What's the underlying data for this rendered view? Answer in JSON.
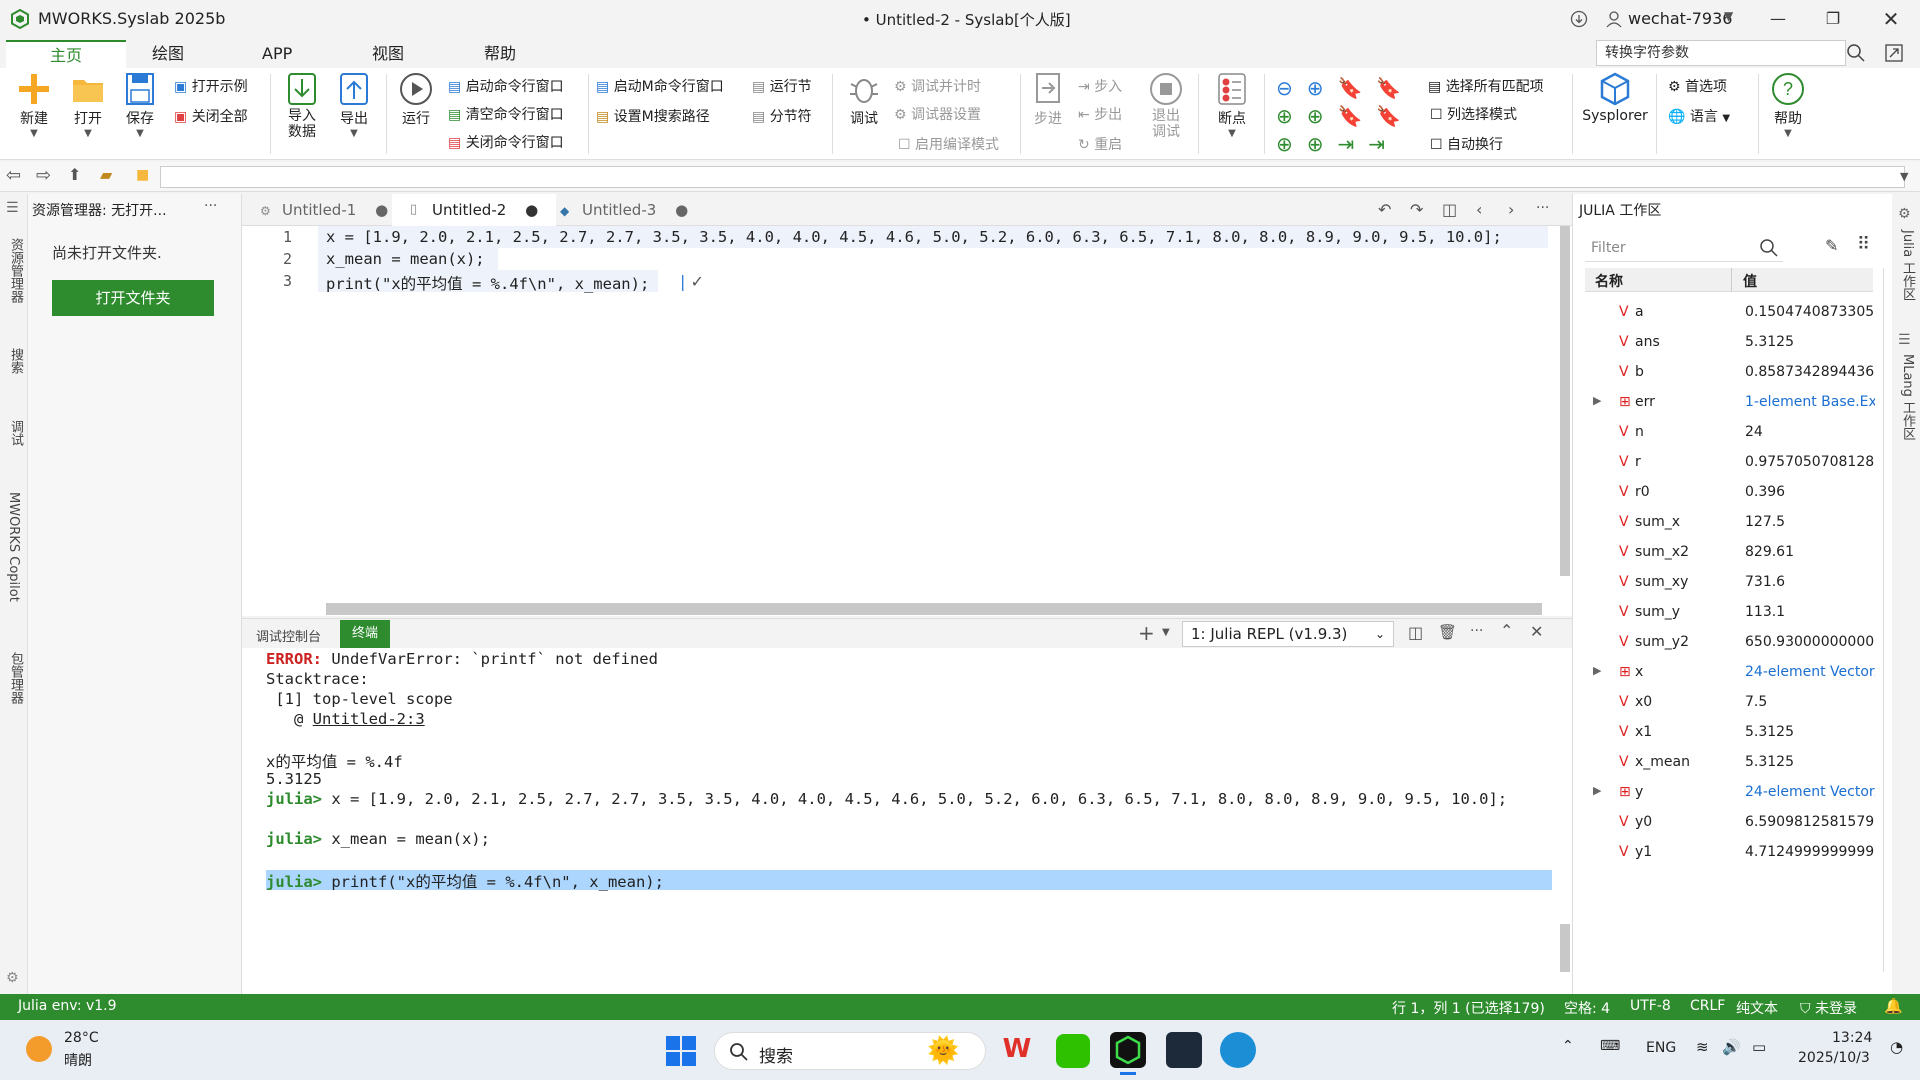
{
  "window": {
    "app_title": "MWORKS.Syslab 2025b",
    "doc_title": "• Untitled-2 - Syslab[个人版]",
    "user": "wechat-7936"
  },
  "menu_tabs": [
    "主页",
    "绘图",
    "APP",
    "视图",
    "帮助"
  ],
  "search_placeholder": "转换字符参数",
  "ribbon": {
    "new": "新建",
    "open": "打开",
    "save": "保存",
    "open_example": "打开示例",
    "close_all": "关闭全部",
    "import": "导入\n数据",
    "export": "导出",
    "run": "运行",
    "start_cmd": "启动命令行窗口",
    "clear_cmd": "清空命令行窗口",
    "close_cmd": "关闭命令行窗口",
    "start_m_cmd": "启动M命令行窗口",
    "set_m_path": "设置M搜索路径",
    "run_section": "运行节",
    "section_sep": "分节符",
    "debug": "调试",
    "debug_timer": "调试并计时",
    "debugger_settings": "调试器设置",
    "enable_compile": "启用编译模式",
    "step_in": "步进",
    "step": "步入",
    "step_out": "步出",
    "restart": "重启",
    "exit_debug": "退出\n调试",
    "breakpoint": "断点",
    "select_all_match": "选择所有匹配项",
    "column_select": "列选择模式",
    "auto_wrap": "自动换行",
    "sysplorer": "Sysplorer",
    "prefs": "首选项",
    "language": "语言",
    "help": "帮助"
  },
  "explorer": {
    "header": "资源管理器: 无打开...",
    "no_folder": "尚未打开文件夹.",
    "open_folder_btn": "打开文件夹"
  },
  "left_strip": [
    "资源管理器",
    "搜索",
    "调试",
    "MWORKS Copilot",
    "包管理器"
  ],
  "editor_tabs": [
    {
      "label": "Untitled-1"
    },
    {
      "label": "Untitled-2"
    },
    {
      "label": "Untitled-3"
    }
  ],
  "code_lines": [
    {
      "num": "1",
      "text": "x = [1.9, 2.0, 2.1, 2.5, 2.7, 2.7, 3.5, 3.5, 4.0, 4.0, 4.5, 4.6, 5.0, 5.2, 6.0, 6.3, 6.5, 7.1, 8.0, 8.0, 8.9, 9.0, 9.5, 10.0];"
    },
    {
      "num": "2",
      "text": "x_mean = mean(x);"
    },
    {
      "num": "3",
      "text": "print(\"x的平均值 = %.4f\\n\", x_mean);"
    }
  ],
  "code_check": "✓",
  "panel_tabs": [
    "调试控制台",
    "终端"
  ],
  "repl_select": "1: Julia REPL (v1.9.3)",
  "terminal": {
    "err_label": "ERROR:",
    "err_msg": " UndefVarError: `printf` not defined",
    "stack": "Stacktrace:",
    "frame": " [1] top-level scope",
    "at": "   @ ",
    "at_link": "Untitled-2:3",
    "out1": "x的平均值 = %.4f",
    "out2": "5.3125",
    "prompt": "julia>",
    "cmd1": " x = [1.9, 2.0, 2.1, 2.5, 2.7, 2.7, 3.5, 3.5, 4.0, 4.0, 4.5, 4.6, 5.0, 5.2, 6.0, 6.3, 6.5, 7.1, 8.0, 8.0, 8.9, 9.0, 9.5, 10.0];",
    "cmd2": " x_mean = mean(x);",
    "cmd3": " printf(\"x的平均值 = %.4f\\n\", x_mean);"
  },
  "workspace": {
    "title": "JULIA 工作区",
    "filter_placeholder": "Filter",
    "col_name": "名称",
    "col_value": "值",
    "rows": [
      {
        "name": "a",
        "value": "0.1504740873305...",
        "kind": "v"
      },
      {
        "name": "ans",
        "value": "5.3125",
        "kind": "v"
      },
      {
        "name": "b",
        "value": "0.8587342894436...",
        "kind": "v"
      },
      {
        "name": "err",
        "value": "1-element Base.Ex...",
        "kind": "arr"
      },
      {
        "name": "n",
        "value": "24",
        "kind": "v"
      },
      {
        "name": "r",
        "value": "0.9757050708128...",
        "kind": "v"
      },
      {
        "name": "r0",
        "value": "0.396",
        "kind": "v"
      },
      {
        "name": "sum_x",
        "value": "127.5",
        "kind": "v"
      },
      {
        "name": "sum_x2",
        "value": "829.61",
        "kind": "v"
      },
      {
        "name": "sum_xy",
        "value": "731.6",
        "kind": "v"
      },
      {
        "name": "sum_y",
        "value": "113.1",
        "kind": "v"
      },
      {
        "name": "sum_y2",
        "value": "650.9300000000001",
        "kind": "v"
      },
      {
        "name": "x",
        "value": "24-element Vector...",
        "kind": "arr"
      },
      {
        "name": "x0",
        "value": "7.5",
        "kind": "v"
      },
      {
        "name": "x1",
        "value": "5.3125",
        "kind": "v"
      },
      {
        "name": "x_mean",
        "value": "5.3125",
        "kind": "v"
      },
      {
        "name": "y",
        "value": "24-element Vector...",
        "kind": "arr"
      },
      {
        "name": "y0",
        "value": "6.5909812581579...",
        "kind": "v"
      },
      {
        "name": "y1",
        "value": "4.7124999999999...",
        "kind": "v"
      }
    ]
  },
  "right_strip": [
    "Julia 工作区",
    "MLang 工作区"
  ],
  "status": {
    "env": "Julia env: v1.9",
    "pos": "行 1，列 1 (已选择179)",
    "spaces": "空格: 4",
    "encoding": "UTF-8",
    "eol": "CRLF",
    "lang": "纯文本",
    "login": "未登录"
  },
  "taskbar": {
    "temp": "28°C",
    "weather": "晴朗",
    "search": "搜索",
    "lang": "ENG",
    "time": "13:24",
    "date": "2025/10/3"
  },
  "colors": {
    "accent": "#2e8b2e",
    "error": "#cc2222",
    "link": "#1a6fd1",
    "selection": "#add6ff"
  }
}
